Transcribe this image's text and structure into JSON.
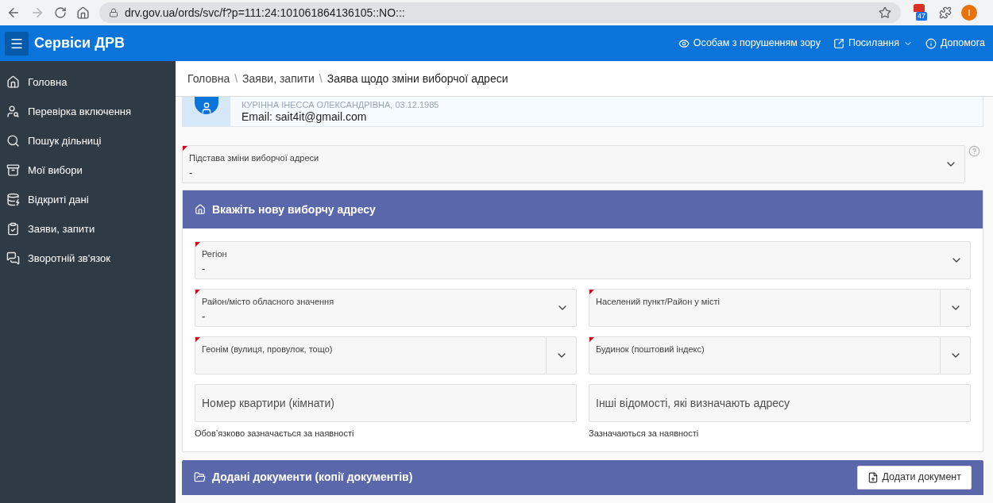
{
  "browser": {
    "url": "drv.gov.ua/ords/svc/f?p=111:24:101061864136105::NO:::",
    "extension_badge": "47",
    "profile_initial": "I"
  },
  "header": {
    "title": "Сервіси ДРВ",
    "links": [
      {
        "label": "Особам з порушенням зору",
        "kind": "eye",
        "dropdown": false
      },
      {
        "label": "Посилання",
        "kind": "external",
        "dropdown": true
      },
      {
        "label": "Допомога",
        "kind": "info",
        "dropdown": false
      }
    ]
  },
  "sidebar": {
    "items": [
      {
        "label": "Головна"
      },
      {
        "label": "Перевірка включення"
      },
      {
        "label": "Пошук дільниці"
      },
      {
        "label": "Мої вибори"
      },
      {
        "label": "Відкриті дані"
      },
      {
        "label": "Заяви, запити"
      },
      {
        "label": "Зворотній зв'язок"
      }
    ]
  },
  "breadcrumb": {
    "separator": "\\",
    "items": [
      "Головна",
      "Заяви, запити",
      "Заява щодо зміни виборчої адреси"
    ]
  },
  "profile": {
    "name": "КУРІННА ІНЕССА ОЛЕКСАНДРІВНА, 03.12.1985",
    "email": "Email: sait4it@gmail.com"
  },
  "basis_field": {
    "label": "Підстава зміни виборчої адреси",
    "value": "-",
    "required": true
  },
  "address_panel": {
    "title": "Вкажіть нову виборчу адресу",
    "fields": [
      {
        "label": "Регіон",
        "value": "-",
        "required": true,
        "kind": "select"
      },
      {
        "label": "Район/місто обласного значення",
        "value": "-",
        "required": true,
        "kind": "select"
      },
      {
        "label": "Населений пункт/Район у місті",
        "required": true,
        "kind": "popup"
      },
      {
        "label": "Геонім (вулиця, провулок, тощо)",
        "required": true,
        "kind": "popup"
      },
      {
        "label": "Будинок (поштовий індекс)",
        "required": true,
        "kind": "popup"
      }
    ],
    "inputs": [
      {
        "placeholder": "Номер квартири (кімнати)",
        "hint": "Обов’язково зазначається за наявності"
      },
      {
        "placeholder": "Інші відомості, які визначають адресу",
        "hint": "Зазначаються за наявності"
      }
    ]
  },
  "documents_panel": {
    "title": "Додані документи (копії документів)",
    "button": "Додати документ"
  }
}
